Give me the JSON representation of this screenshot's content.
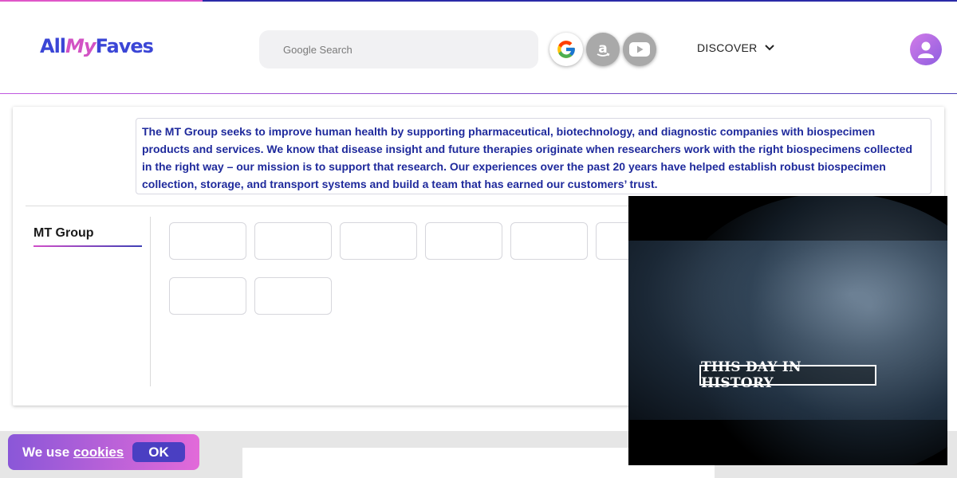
{
  "header": {
    "logo_all": "All",
    "logo_my": "My",
    "logo_faves": "Faves",
    "search_placeholder": "Google Search",
    "engines": [
      "google-icon",
      "amazon-icon",
      "youtube-icon"
    ],
    "discover_label": "DISCOVER"
  },
  "main": {
    "description": "The MT Group seeks to improve human health by supporting pharmaceutical, biotechnology, and diagnostic companies with biospecimen products and services. We know that disease insight and future therapies originate when researchers work with the right biospecimens collected in the right way – our mission is to support that research. Our experiences over the past 20 years have helped establish robust biospecimen collection, storage, and transport systems and build a team that has earned our customers’ trust.",
    "group_tab": "MT Group"
  },
  "video": {
    "title": "THIS DAY IN HISTORY"
  },
  "cookie": {
    "prefix": "We use ",
    "link": "cookies",
    "ok_label": "OK"
  },
  "colors": {
    "brand_blue": "#3b46d6",
    "brand_pink": "#d253c4",
    "desc_text": "#1f2a9c"
  }
}
